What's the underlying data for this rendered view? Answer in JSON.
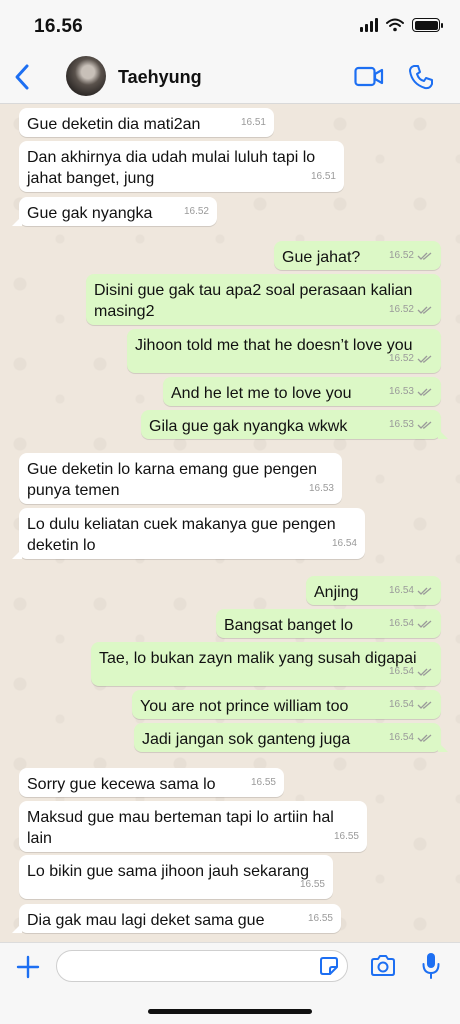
{
  "status": {
    "time": "16.56"
  },
  "header": {
    "contact_name": "Taehyung"
  },
  "colors": {
    "accent": "#1d6ff2",
    "incoming": "#ffffff",
    "outgoing": "#dcf8c6",
    "background": "#efe7dd"
  },
  "icons": {
    "back": "chevron-left-icon",
    "video": "video-camera-icon",
    "call": "phone-icon",
    "read_receipt": "double-check-icon"
  },
  "messages": [
    {
      "dir": "in",
      "text": "Gue deketin dia mati2an",
      "time": "16.51"
    },
    {
      "dir": "in",
      "lines": [
        "Dan akhirnya dia udah mulai luluh tapi lo",
        "jahat banget, jung"
      ],
      "time": "16.51"
    },
    {
      "dir": "in",
      "text": "Gue gak nyangka",
      "time": "16.52"
    },
    {
      "dir": "out",
      "text": "Gue jahat?",
      "time": "16.52"
    },
    {
      "dir": "out",
      "lines": [
        "Disini gue gak tau apa2 soal perasaan kalian",
        "masing2"
      ],
      "time": "16.52"
    },
    {
      "dir": "out",
      "text": "Jihoon told me that he doesn’t love you",
      "time": "16.52"
    },
    {
      "dir": "out",
      "text": "And he let me to love you",
      "time": "16.53"
    },
    {
      "dir": "out",
      "text": "Gila gue gak nyangka wkwk",
      "time": "16.53"
    },
    {
      "dir": "in",
      "lines": [
        "Gue deketin lo karna emang gue pengen",
        "punya temen"
      ],
      "time": "16.53"
    },
    {
      "dir": "in",
      "lines": [
        "Lo dulu keliatan cuek makanya gue pengen",
        "deketin lo"
      ],
      "time": "16.54"
    },
    {
      "dir": "out",
      "text": "Anjing",
      "time": "16.54"
    },
    {
      "dir": "out",
      "text": "Bangsat banget lo",
      "time": "16.54"
    },
    {
      "dir": "out",
      "text": "Tae, lo bukan zayn malik yang susah digapai",
      "time": "16.54"
    },
    {
      "dir": "out",
      "text": "You are not prince william too",
      "time": "16.54"
    },
    {
      "dir": "out",
      "text": "Jadi jangan sok ganteng juga",
      "time": "16.54"
    },
    {
      "dir": "in",
      "text": "Sorry gue kecewa sama lo",
      "time": "16.55"
    },
    {
      "dir": "in",
      "lines": [
        "Maksud gue mau berteman tapi lo artiin hal",
        "lain"
      ],
      "time": "16.55"
    },
    {
      "dir": "in",
      "lines": [
        "Lo bikin gue sama jihoon jauh sekarang",
        ""
      ],
      "time": "16.55"
    },
    {
      "dir": "in",
      "text": "Dia gak mau lagi deket sama gue",
      "time": "16.55"
    }
  ],
  "composer": {
    "placeholder": ""
  }
}
